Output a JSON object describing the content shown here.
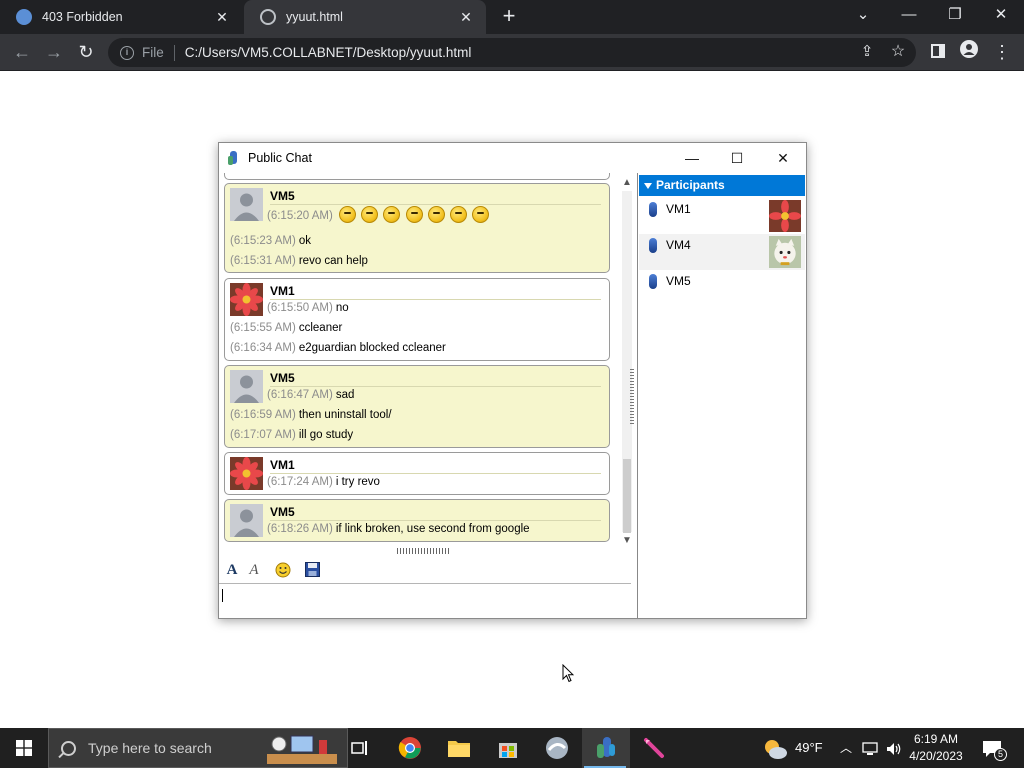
{
  "browser": {
    "tabs": [
      {
        "title": "403 Forbidden",
        "close": "✕"
      },
      {
        "title": "yyuut.html",
        "close": "✕"
      }
    ],
    "new_tab": "+",
    "window_controls": {
      "dropdown": "⌄",
      "minimize": "—",
      "restore": "❐",
      "close": "✕"
    },
    "address": {
      "scheme": "File",
      "url": "C:/Users/VM5.COLLABNET/Desktop/yyuut.html"
    }
  },
  "chat_window": {
    "title": "Public Chat",
    "controls": {
      "minimize": "—",
      "maximize": "☐",
      "close": "✕"
    },
    "messages": [
      {
        "sender": "VM5",
        "style": "yellow",
        "avatar": "default-avatar",
        "lines": [
          {
            "time": "(6:15:20 AM)",
            "text": "",
            "emoji_count": 7
          },
          {
            "time": "(6:15:23 AM)",
            "text": "ok"
          },
          {
            "time": "(6:15:31 AM)",
            "text": "revo can help"
          }
        ]
      },
      {
        "sender": "VM1",
        "style": "white",
        "avatar": "flower-avatar",
        "lines": [
          {
            "time": "(6:15:50 AM)",
            "text": "no"
          },
          {
            "time": "(6:15:55 AM)",
            "text": "ccleaner"
          },
          {
            "time": "(6:16:34 AM)",
            "text": "e2guardian blocked ccleaner"
          }
        ]
      },
      {
        "sender": "VM5",
        "style": "yellow",
        "avatar": "default-avatar",
        "lines": [
          {
            "time": "(6:16:47 AM)",
            "text": "sad"
          },
          {
            "time": "(6:16:59 AM)",
            "text": "then uninstall tool/"
          },
          {
            "time": "(6:17:07 AM)",
            "text": "ill go study"
          }
        ]
      },
      {
        "sender": "VM1",
        "style": "white",
        "avatar": "flower-avatar",
        "lines": [
          {
            "time": "(6:17:24 AM)",
            "text": "i try revo"
          }
        ]
      },
      {
        "sender": "VM5",
        "style": "yellow",
        "avatar": "default-avatar",
        "lines": [
          {
            "time": "(6:18:26 AM)",
            "text": "if link broken, use second from google"
          }
        ]
      }
    ],
    "scroll": {
      "up": "▲",
      "down": "▼",
      "position": 0.95
    },
    "format_toolbar": {
      "font": "A",
      "style": "A"
    },
    "input_value": "",
    "participants": {
      "header": "Participants",
      "items": [
        {
          "name": "VM1",
          "avatar": "flower-avatar"
        },
        {
          "name": "VM4",
          "avatar": "cat-avatar"
        },
        {
          "name": "VM5",
          "avatar": ""
        }
      ]
    }
  },
  "taskbar": {
    "search_placeholder": "Type here to search",
    "weather": "49°F",
    "time": "6:19 AM",
    "date": "4/20/2023",
    "notifications": "5"
  },
  "colors": {
    "browser_dark": "#202124",
    "browser_toolbar": "#35363a",
    "selection_blue": "#0078d7",
    "message_yellow": "#f6f6cd",
    "taskbar": "#202020"
  }
}
